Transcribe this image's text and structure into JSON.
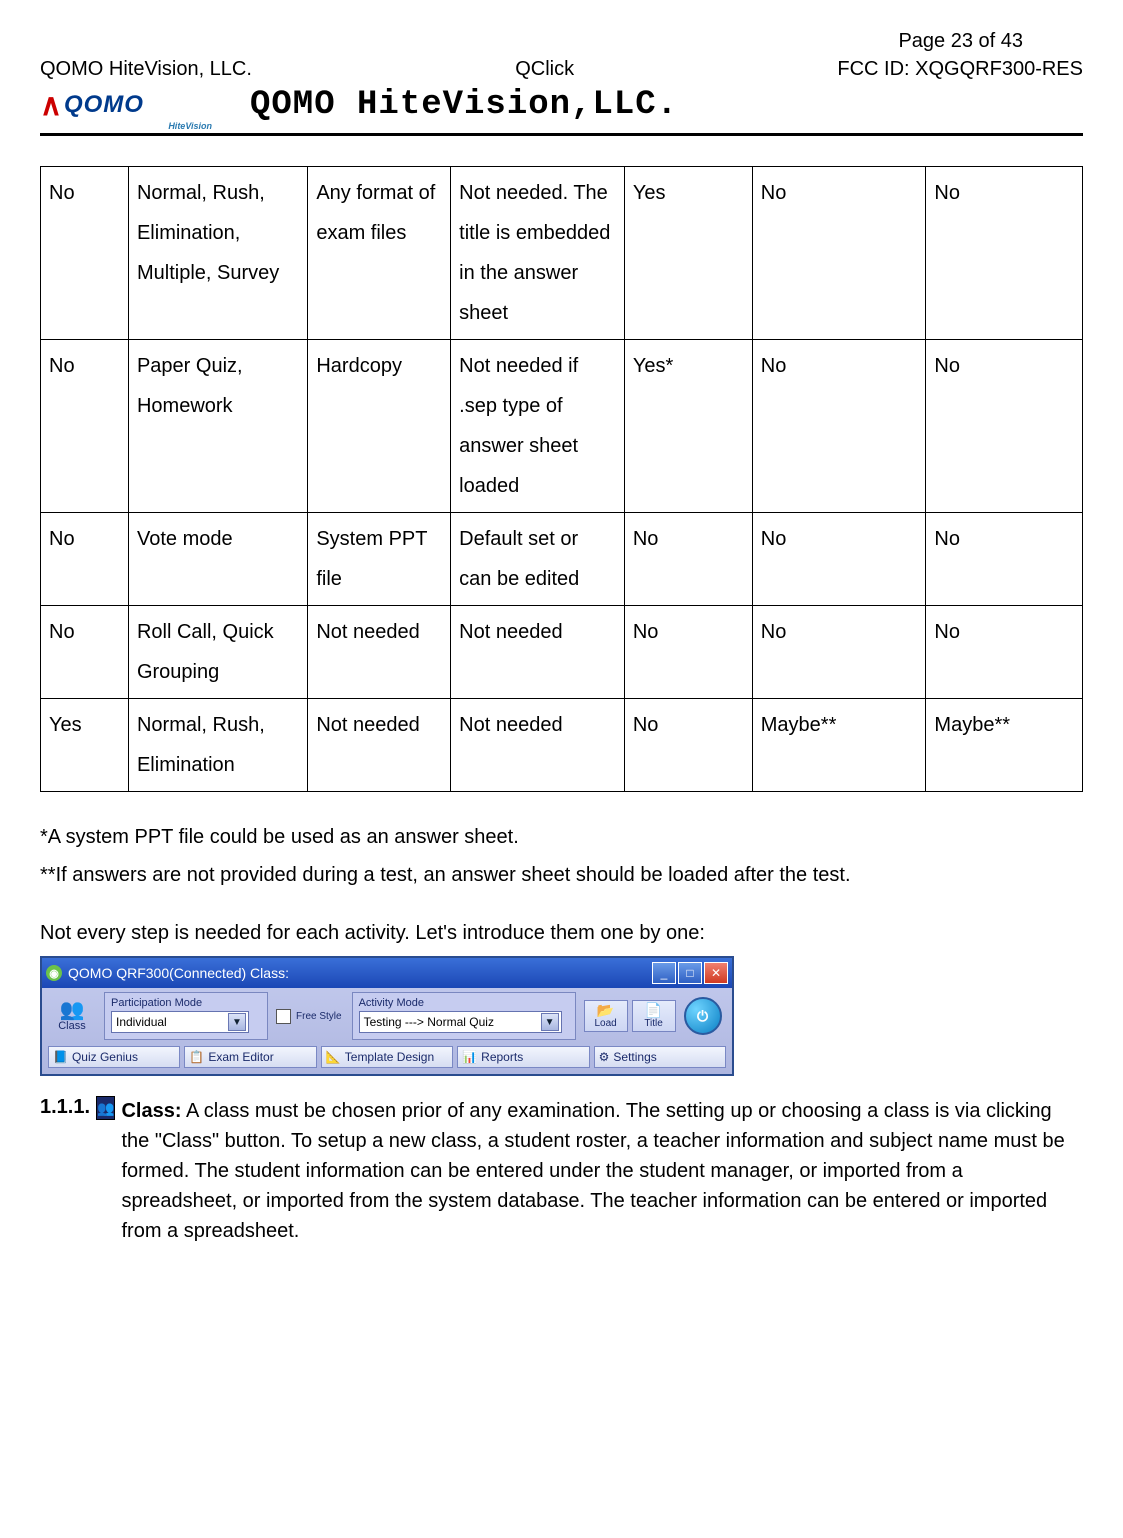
{
  "header": {
    "left": "QOMO HiteVision, LLC.",
    "center": "QClick",
    "pagenum": "Page 23 of 43",
    "fcc": "FCC ID: XQGQRF300-RES",
    "logo_brand": "QOMO",
    "logo_sub": "HiteVision",
    "company_title": "QOMO HiteVision,LLC."
  },
  "table_rows": [
    [
      "No",
      "Normal, Rush, Elimination, Multiple, Survey",
      "Any format of exam files",
      "Not needed. The title is embedded in the answer sheet",
      "Yes",
      "No",
      "No"
    ],
    [
      "No",
      "Paper Quiz, Homework",
      "Hardcopy",
      "Not needed if  .sep type of answer sheet loaded",
      "Yes*",
      "No",
      "No"
    ],
    [
      "No",
      "Vote mode",
      "System PPT file",
      "Default set or can be edited",
      "No",
      "No",
      "No"
    ],
    [
      "No",
      "Roll Call, Quick Grouping",
      "Not needed",
      "Not needed",
      "No",
      "No",
      "No"
    ],
    [
      "Yes",
      "Normal, Rush, Elimination",
      "Not needed",
      "Not needed",
      "No",
      "Maybe**",
      "Maybe**"
    ]
  ],
  "notes": {
    "n1": "*A system PPT file could be used as an answer sheet.",
    "n2": "**If answers are not provided during a test, an answer sheet should be loaded after the test.",
    "n3": "Not every step is needed for each activity. Let's introduce them one by one:"
  },
  "app": {
    "title": "QOMO QRF300(Connected) Class:",
    "class_label": "Class",
    "participation_label": "Participation Mode",
    "participation_value": "Individual",
    "freestyle_label": "Free Style",
    "activity_label": "Activity Mode",
    "activity_value": "Testing ---> Normal Quiz",
    "load_label": "Load",
    "title_btn_label": "Title",
    "buttons": [
      "Quiz Genius",
      "Exam Editor",
      "Template Design",
      "Reports",
      "Settings"
    ]
  },
  "section": {
    "num": "1.1.1.",
    "heading": "Class:",
    "body": "A class must be chosen prior of any examination. The setting up or choosing a class is via clicking the \"Class\" button.  To setup a new class, a student roster, a teacher information and subject name must be formed. The student information can be entered under the student manager, or imported from a spreadsheet, or imported from the system database. The teacher information can be entered or imported from a spreadsheet."
  }
}
